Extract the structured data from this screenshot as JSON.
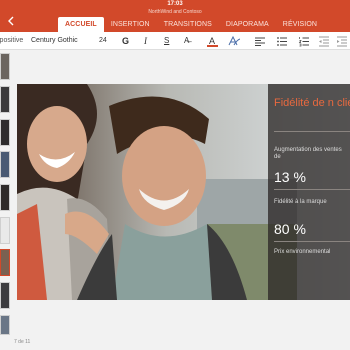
{
  "status": {
    "time": "17:03"
  },
  "document": {
    "title": "NorthWind and Contoso"
  },
  "ribbon": {
    "tabs": [
      {
        "label": "ACCUEIL"
      },
      {
        "label": "INSERTION"
      },
      {
        "label": "TRANSITIONS"
      },
      {
        "label": "DIAPORAMA"
      },
      {
        "label": "RÉVISION"
      }
    ],
    "active_tab": "ACCUEIL"
  },
  "toolbar": {
    "style_label": "ipositive",
    "font_name": "Century Gothic",
    "font_size": "24",
    "bold": "G",
    "italic": "I",
    "underline": "S",
    "strike": "A̶",
    "font_color_letter": "A",
    "icons": [
      "font-color-icon",
      "text-effects-icon",
      "align-left-icon",
      "bullets-icon",
      "numbering-icon",
      "decrease-indent-icon",
      "increase-indent-icon"
    ]
  },
  "slide": {
    "title": "Fidélité de n clients",
    "stats": [
      {
        "label": "Augmentation des ventes de",
        "value": "13 %"
      },
      {
        "label": "Fidélité à la marque",
        "value": "80 %"
      },
      {
        "label": "Prix environnemental",
        "value": ""
      }
    ]
  },
  "footer": {
    "slide_counter": "7 de 11"
  },
  "colors": {
    "accent": "#d2492a",
    "overlay": "#2d2928",
    "title_orange": "#e8693f"
  }
}
